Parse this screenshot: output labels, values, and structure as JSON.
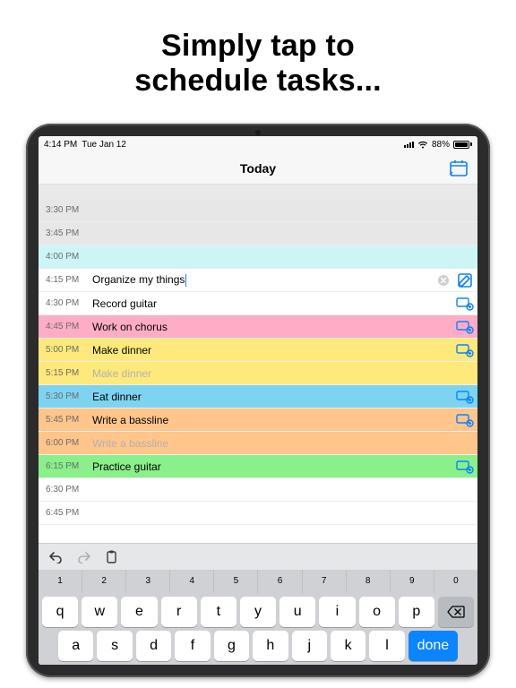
{
  "hero": {
    "line1": "Simply tap to",
    "line2": "schedule tasks..."
  },
  "status": {
    "time": "4:14 PM",
    "date": "Tue Jan 12",
    "battery_pct": "88%"
  },
  "nav": {
    "title": "Today"
  },
  "slots": [
    {
      "time": "3:30 PM",
      "task": "",
      "bg": "#e7e7e7",
      "action": null,
      "faded": false
    },
    {
      "time": "3:45 PM",
      "task": "",
      "bg": "#e7e7e7",
      "action": null,
      "faded": false
    },
    {
      "time": "4:00 PM",
      "task": "",
      "bg": "#cdf5f6",
      "action": null,
      "faded": false
    },
    {
      "time": "4:15 PM",
      "task": "Organize my things",
      "bg": "#ffffff",
      "action": "edit",
      "editing": true,
      "faded": false
    },
    {
      "time": "4:30 PM",
      "task": "Record guitar",
      "bg": "#ffffff",
      "action": "addsim",
      "faded": false
    },
    {
      "time": "4:45 PM",
      "task": "Work on chorus",
      "bg": "#ffadc6",
      "action": "addsim",
      "faded": false
    },
    {
      "time": "5:00 PM",
      "task": "Make dinner",
      "bg": "#ffe97a",
      "action": "addsim",
      "faded": false
    },
    {
      "time": "5:15 PM",
      "task": "Make dinner",
      "bg": "#ffe97a",
      "action": null,
      "faded": true
    },
    {
      "time": "5:30 PM",
      "task": "Eat dinner",
      "bg": "#7dd4f0",
      "action": "addsim",
      "faded": false
    },
    {
      "time": "5:45 PM",
      "task": "Write a bassline",
      "bg": "#ffc58a",
      "action": "addsim",
      "faded": false
    },
    {
      "time": "6:00 PM",
      "task": "Write a bassline",
      "bg": "#ffc58a",
      "action": null,
      "faded": true
    },
    {
      "time": "6:15 PM",
      "task": "Practice guitar",
      "bg": "#8af08a",
      "action": "addsim",
      "faded": false
    },
    {
      "time": "6:30 PM",
      "task": "",
      "bg": "#ffffff",
      "action": null,
      "faded": false
    },
    {
      "time": "6:45 PM",
      "task": "",
      "bg": "#ffffff",
      "action": null,
      "faded": false
    }
  ],
  "keyboard": {
    "done": "done",
    "num_row": [
      {
        "n": "1",
        "s": ""
      },
      {
        "n": "2",
        "s": ""
      },
      {
        "n": "3",
        "s": ""
      },
      {
        "n": "4",
        "s": ""
      },
      {
        "n": "5",
        "s": ""
      },
      {
        "n": "6",
        "s": ""
      },
      {
        "n": "7",
        "s": ""
      },
      {
        "n": "8",
        "s": ""
      },
      {
        "n": "9",
        "s": ""
      },
      {
        "n": "0",
        "s": ""
      }
    ],
    "row1": [
      "q",
      "w",
      "e",
      "r",
      "t",
      "y",
      "u",
      "i",
      "o",
      "p"
    ],
    "row2": [
      "a",
      "s",
      "d",
      "f",
      "g",
      "h",
      "j",
      "k",
      "l"
    ]
  }
}
